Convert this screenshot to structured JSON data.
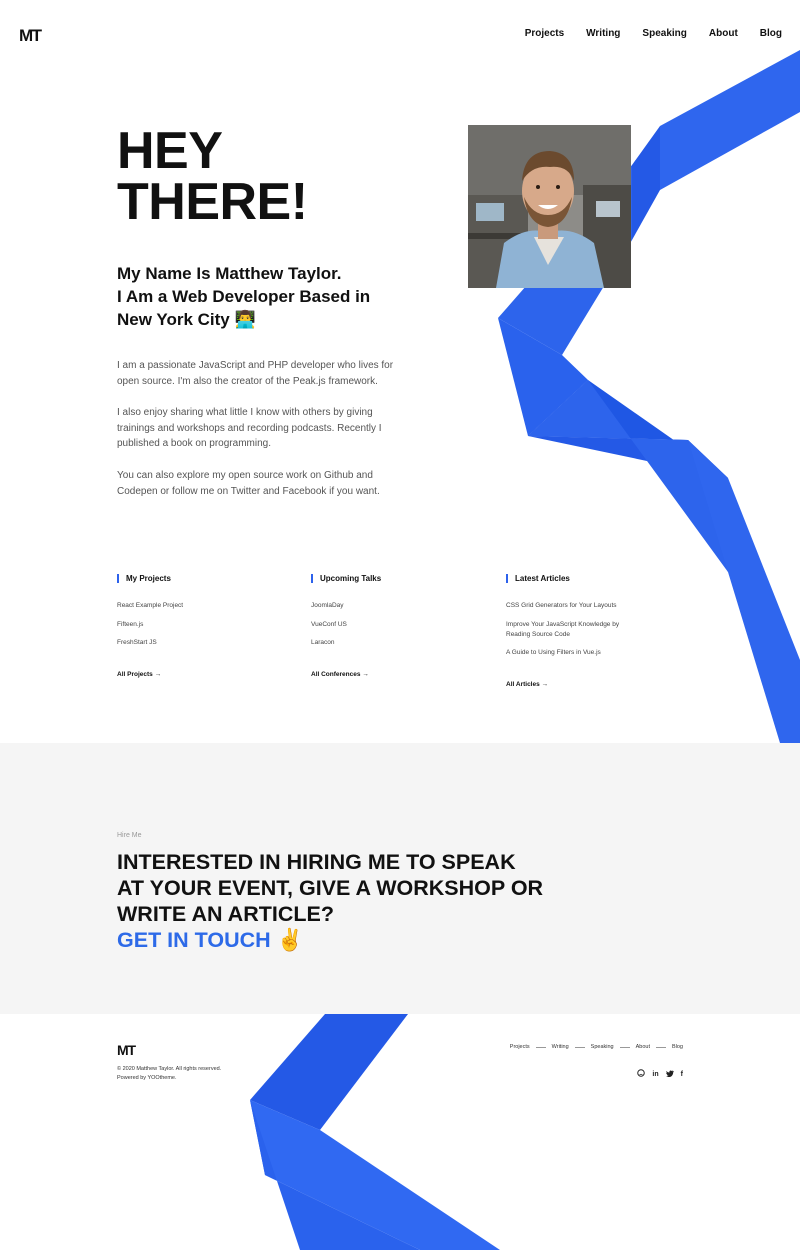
{
  "logo": "MT",
  "nav": [
    "Projects",
    "Writing",
    "Speaking",
    "About",
    "Blog"
  ],
  "hero": {
    "title_lines": [
      "HEY",
      "THERE!"
    ],
    "subtitle_lines": [
      "My Name Is Matthew Taylor.",
      "I Am a Web Developer Based in",
      "New York City 👨‍💻"
    ],
    "bio": [
      "I am a passionate JavaScript and PHP developer who lives for open source. I'm also the creator of the Peak.js framework.",
      "I also enjoy sharing what little I know with others by giving trainings and workshops and recording podcasts. Recently I published a book on programming.",
      "You can also explore my open source work on Github and Codepen or follow me on Twitter and Facebook if you want."
    ]
  },
  "columns": [
    {
      "title": "My Projects",
      "items": [
        "React Example Project",
        "Fifteen.js",
        "FreshStart JS"
      ],
      "more": "All Projects →"
    },
    {
      "title": "Upcoming Talks",
      "items": [
        "JoomlaDay",
        "VueConf US",
        "Laracon"
      ],
      "more": "All Conferences →"
    },
    {
      "title": "Latest Articles",
      "items": [
        "CSS Grid Generators for Your Layouts",
        "Improve Your JavaScript Knowledge by Reading Source Code",
        "A Guide to Using Filters in Vue.js"
      ],
      "more": "All Articles →"
    }
  ],
  "hire": {
    "eyebrow": "Hire Me",
    "lines": [
      "INTERESTED IN HIRING ME TO SPEAK",
      "AT YOUR EVENT, GIVE A WORKSHOP OR",
      "WRITE AN ARTICLE?"
    ],
    "cta": "GET IN TOUCH",
    "emoji": "✌️"
  },
  "footer": {
    "logo": "MT",
    "copyright": "© 2020 Matthew Taylor. All rights reserved.",
    "powered": "Powered by YOOtheme.",
    "nav": [
      "Projects",
      "Writing",
      "Speaking",
      "About",
      "Blog"
    ],
    "social_icons": [
      "github-icon",
      "linkedin-icon",
      "twitter-icon",
      "facebook-icon"
    ]
  },
  "colors": {
    "accent": "#2d6ae8",
    "ribbon_light": "#3b6ff5",
    "ribbon_dark": "#1f56e4",
    "hire_bg": "#f5f5f5"
  }
}
